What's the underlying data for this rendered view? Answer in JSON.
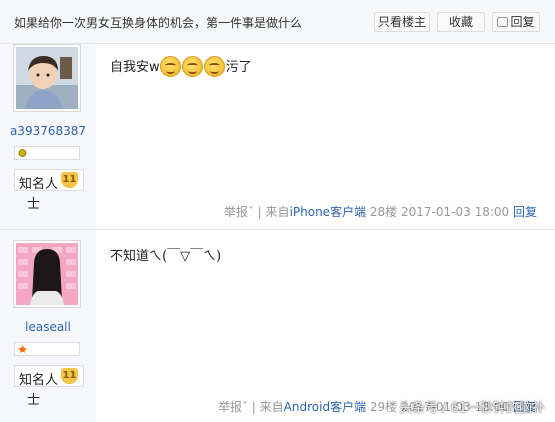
{
  "header": {
    "title": "如果给你一次男女互换身体的机会，第一件事是做什么",
    "only_op_label": "只看楼主",
    "favorite_label": "收藏",
    "reply_label": "回复"
  },
  "posts": [
    {
      "username": "a393768387",
      "level_title": "知名人",
      "level_title_tail": "士",
      "level": "11",
      "content_before": "自我安w",
      "emoji_count": 3,
      "content_after": "污了",
      "report_label": "举报ˇ",
      "separator": "|",
      "client_prefix": "来自",
      "client": "iPhone客户端",
      "floor": "28楼",
      "timestamp": "2017-01-03 18:00",
      "reply_label": "回复",
      "avatar": "boy-photo",
      "badge_color": "#c8b400"
    },
    {
      "username": "leaseall",
      "level_title": "知名人",
      "level_title_tail": "士",
      "level": "11",
      "content": "不知道ㄟ(￣▽￣ㄟ)",
      "report_label": "举报ˇ",
      "separator": "|",
      "client_prefix": "来自",
      "client": "Android客户端",
      "floor": "29楼",
      "timestamp": "2017-01-03 18:00",
      "reply_label": "回复",
      "avatar": "girl-long-hair-photo",
      "badge_color": "#ff6a00"
    }
  ],
  "watermark": "头条号 / 61一秒钟的脑补"
}
